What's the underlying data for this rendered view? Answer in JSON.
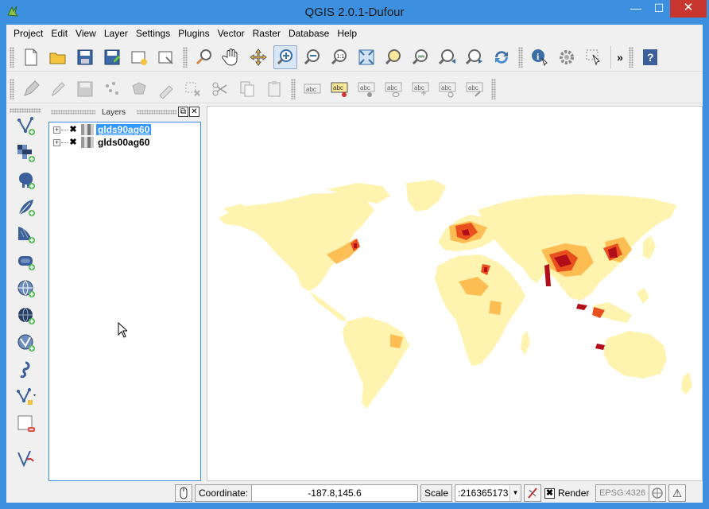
{
  "window": {
    "title": "QGIS 2.0.1-Dufour",
    "minimize_glyph": "—",
    "maximize_glyph": "☐",
    "close_glyph": "✕"
  },
  "menubar": {
    "items": [
      "Project",
      "Edit",
      "View",
      "Layer",
      "Settings",
      "Plugins",
      "Vector",
      "Raster",
      "Database",
      "Help"
    ]
  },
  "toolbar_file": {
    "icons": [
      "new-project-icon",
      "open-project-icon",
      "save-project-icon",
      "save-as-icon",
      "new-print-composer-icon",
      "composer-manager-icon"
    ]
  },
  "toolbar_nav": {
    "icons": [
      "touch-zoom-icon",
      "pan-hand-icon",
      "pan-to-selection-icon",
      "zoom-in-icon",
      "zoom-out-icon",
      "zoom-actual-size-icon",
      "zoom-full-icon",
      "zoom-to-selection-icon",
      "zoom-to-layer-icon",
      "zoom-last-icon",
      "zoom-next-icon",
      "refresh-icon"
    ],
    "active": "zoom-in-icon"
  },
  "toolbar_attr": {
    "icons": [
      "identify-icon",
      "action-gear-icon",
      "select-features-icon",
      "help-icon"
    ],
    "more_glyph": "»"
  },
  "toolbar_label": {
    "labels": [
      "abc",
      "abc",
      "abc",
      "abc",
      "abc",
      "abc",
      "abc"
    ]
  },
  "layers_panel": {
    "title": "Layers",
    "float_glyph": "⧉",
    "close_glyph": "✕",
    "layers": [
      {
        "name": "glds90ag60",
        "checked": true,
        "selected": true,
        "check_glyph": "✖",
        "expand_glyph": "+"
      },
      {
        "name": "glds00ag60",
        "checked": true,
        "selected": false,
        "check_glyph": "✖",
        "expand_glyph": "+"
      }
    ]
  },
  "statusbar": {
    "coordinate_label": "Coordinate:",
    "coordinate_value": "-187.8,145.6",
    "scale_label": "Scale",
    "scale_value": ":216365173",
    "scale_arrow": "▼",
    "render_check": "✖",
    "render_label": "Render",
    "crs_label": "EPSG:4326",
    "warning_glyph": "⚠"
  },
  "colors": {
    "titlebar": "#3d8fe0",
    "close": "#c7372f",
    "land_low": "#fff3b0",
    "land_mid": "#fdb84a",
    "land_high": "#e8501d",
    "land_peak": "#b10d1a",
    "selection": "#3399ff"
  }
}
